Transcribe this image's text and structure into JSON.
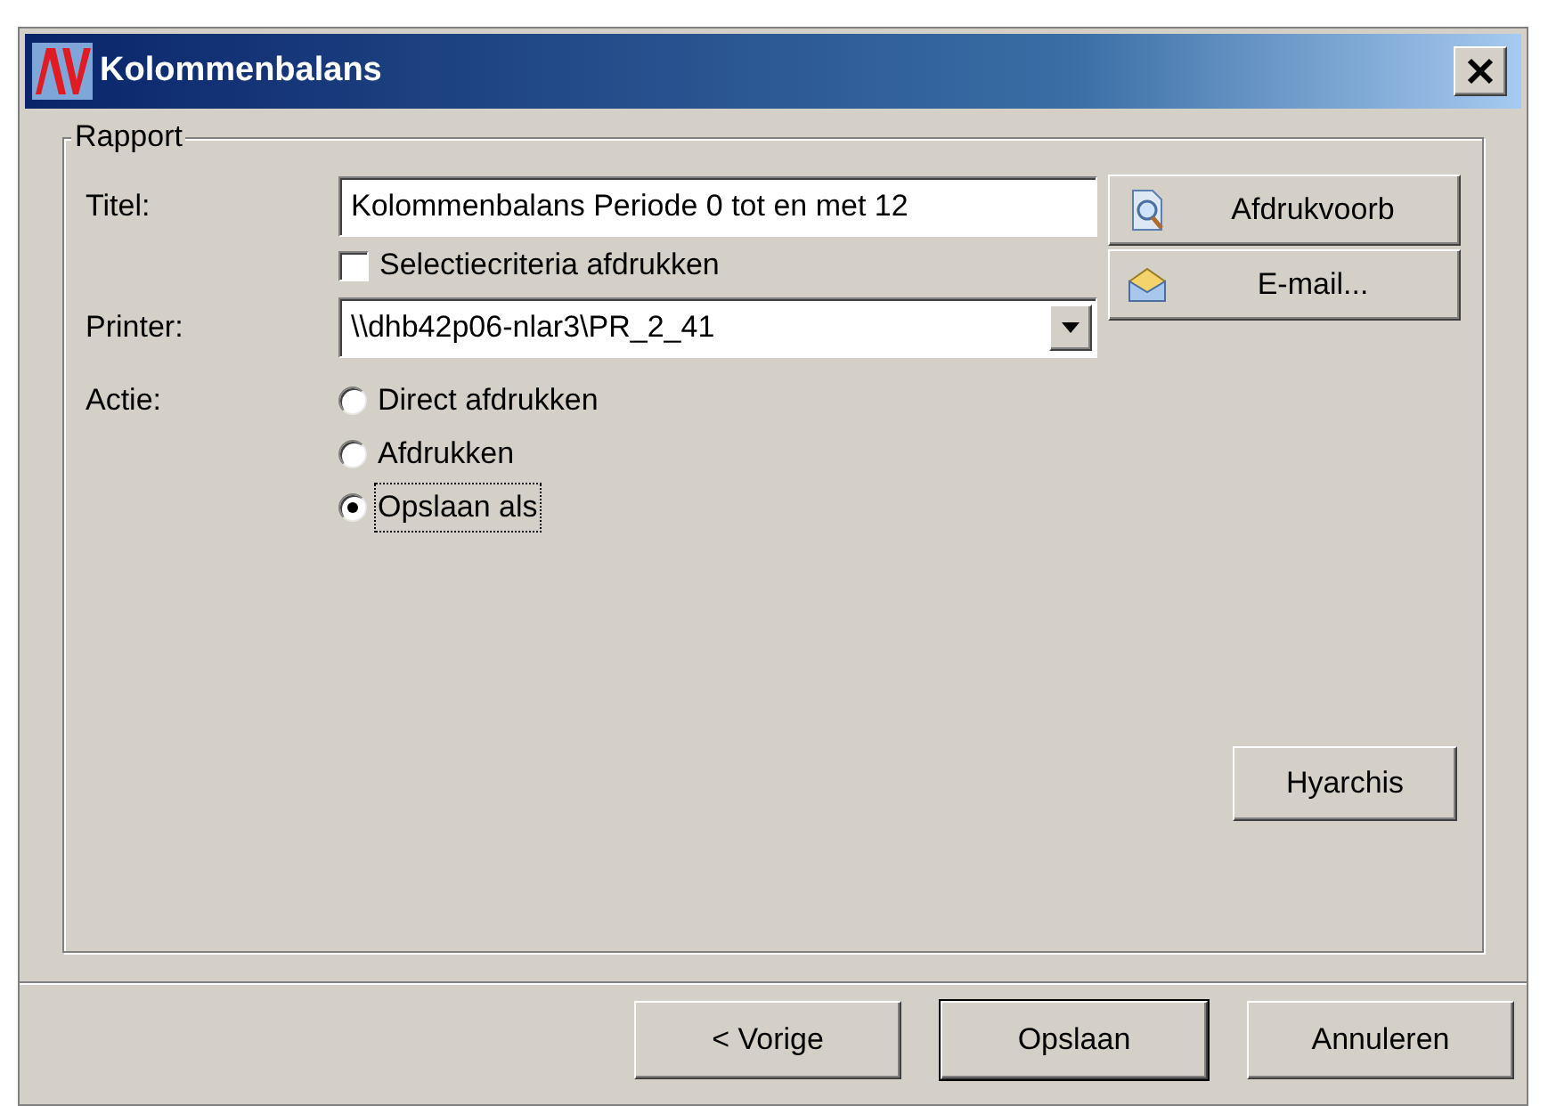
{
  "window": {
    "title": "Kolommenbalans"
  },
  "group": {
    "title": "Rapport"
  },
  "titel": {
    "label": "Titel:",
    "value": "Kolommenbalans Periode 0 tot en met 12"
  },
  "selectie": {
    "label": "Selectiecriteria afdrukken",
    "checked": false
  },
  "printer": {
    "label": "Printer:",
    "value": "\\\\dhb42p06-nlar3\\PR_2_41"
  },
  "actie": {
    "label": "Actie:",
    "options": [
      {
        "label": "Direct afdrukken",
        "selected": false
      },
      {
        "label": "Afdrukken",
        "selected": false
      },
      {
        "label": "Opslaan als",
        "selected": true
      }
    ]
  },
  "side_buttons": [
    {
      "kind": "preview",
      "label": "Afdrukvoorb"
    },
    {
      "kind": "email",
      "label": "E-mail..."
    }
  ],
  "hyarchis": {
    "label": "Hyarchis"
  },
  "footer_buttons": [
    {
      "label": "< Vorige",
      "default": false
    },
    {
      "label": "Opslaan",
      "default": true
    },
    {
      "label": "Annuleren",
      "default": false
    }
  ]
}
